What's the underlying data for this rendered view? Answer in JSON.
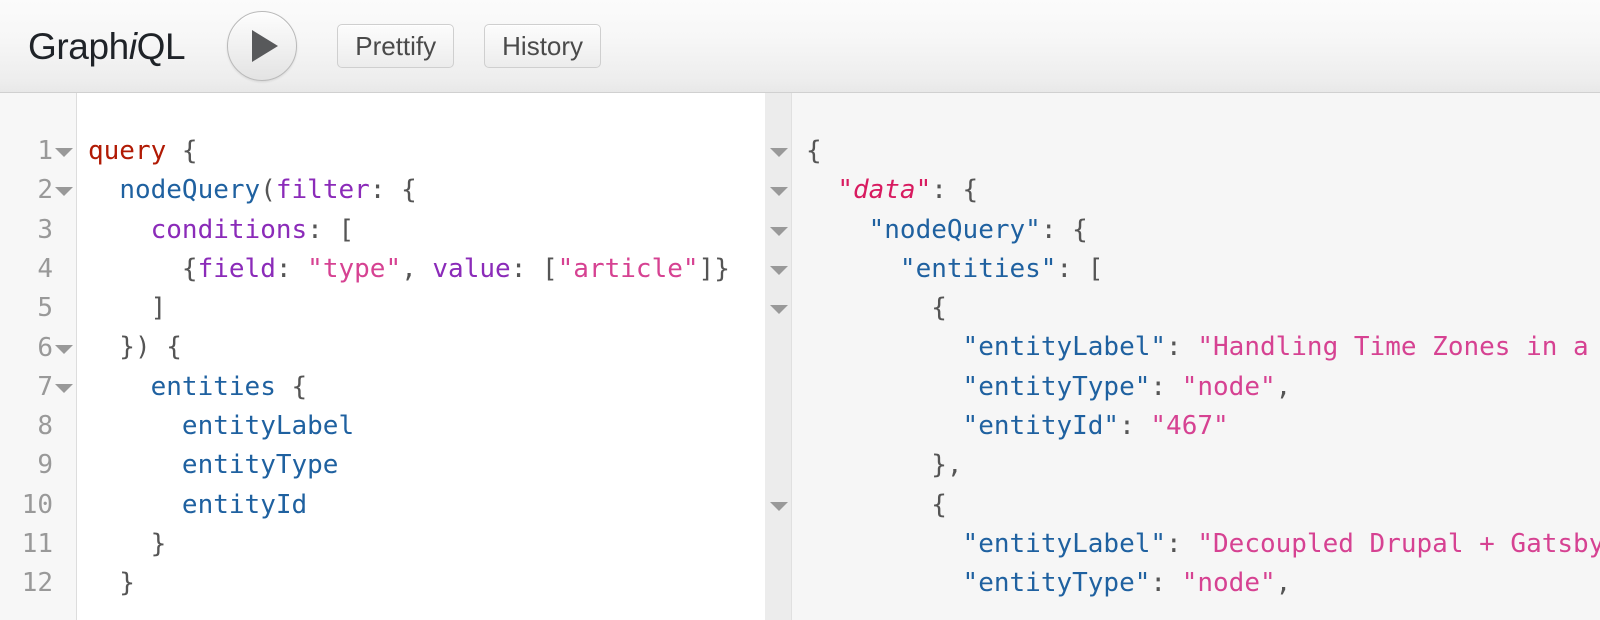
{
  "app": {
    "title": "GraphiQL",
    "title_prefix": "Graph",
    "title_em": "i",
    "title_suffix": "QL"
  },
  "toolbar": {
    "execute_label": "",
    "execute_icon": "play-icon",
    "prettify_label": "Prettify",
    "history_label": "History"
  },
  "query_editor": {
    "line_numbers": [
      "1",
      "2",
      "3",
      "4",
      "5",
      "6",
      "7",
      "8",
      "9",
      "10",
      "11",
      "12"
    ],
    "fold_lines": [
      1,
      2,
      6,
      7
    ],
    "lines": [
      [
        {
          "text": "query",
          "cls": "t-kw"
        },
        {
          "text": " {",
          "cls": "t-punct"
        }
      ],
      [
        {
          "text": "  ",
          "cls": "t-punct"
        },
        {
          "text": "nodeQuery",
          "cls": "t-def"
        },
        {
          "text": "(",
          "cls": "t-punct"
        },
        {
          "text": "filter",
          "cls": "t-attr"
        },
        {
          "text": ": {",
          "cls": "t-punct"
        }
      ],
      [
        {
          "text": "    ",
          "cls": "t-punct"
        },
        {
          "text": "conditions",
          "cls": "t-attr"
        },
        {
          "text": ": [",
          "cls": "t-punct"
        }
      ],
      [
        {
          "text": "      {",
          "cls": "t-punct"
        },
        {
          "text": "field",
          "cls": "t-attr"
        },
        {
          "text": ": ",
          "cls": "t-punct"
        },
        {
          "text": "\"type\"",
          "cls": "t-str"
        },
        {
          "text": ", ",
          "cls": "t-punct"
        },
        {
          "text": "value",
          "cls": "t-attr"
        },
        {
          "text": ": [",
          "cls": "t-punct"
        },
        {
          "text": "\"article\"",
          "cls": "t-str"
        },
        {
          "text": "]}",
          "cls": "t-punct"
        }
      ],
      [
        {
          "text": "    ]",
          "cls": "t-punct"
        }
      ],
      [
        {
          "text": "  }) {",
          "cls": "t-punct"
        }
      ],
      [
        {
          "text": "    ",
          "cls": "t-punct"
        },
        {
          "text": "entities",
          "cls": "t-def"
        },
        {
          "text": " {",
          "cls": "t-punct"
        }
      ],
      [
        {
          "text": "      ",
          "cls": "t-punct"
        },
        {
          "text": "entityLabel",
          "cls": "t-def"
        }
      ],
      [
        {
          "text": "      ",
          "cls": "t-punct"
        },
        {
          "text": "entityType",
          "cls": "t-def"
        }
      ],
      [
        {
          "text": "      ",
          "cls": "t-punct"
        },
        {
          "text": "entityId",
          "cls": "t-def"
        }
      ],
      [
        {
          "text": "    }",
          "cls": "t-punct"
        }
      ],
      [
        {
          "text": "  }",
          "cls": "t-punct"
        }
      ]
    ],
    "plain_text": "query {\n  nodeQuery(filter: {\n    conditions: [\n      {field: \"type\", value: [\"article\"]}\n    ]\n  }) {\n    entities {\n      entityLabel\n      entityType\n      entityId\n    }\n  }"
  },
  "result_viewer": {
    "fold_lines": [
      1,
      2,
      3,
      4,
      5,
      10
    ],
    "lines": [
      [
        {
          "text": "{",
          "cls": "t-brace"
        }
      ],
      [
        {
          "text": "  ",
          "cls": "t-brace"
        },
        {
          "text": "\"data\"",
          "cls": "t-data"
        },
        {
          "text": ": {",
          "cls": "t-brace"
        }
      ],
      [
        {
          "text": "    ",
          "cls": "t-brace"
        },
        {
          "text": "\"nodeQuery\"",
          "cls": "t-prop"
        },
        {
          "text": ": {",
          "cls": "t-brace"
        }
      ],
      [
        {
          "text": "      ",
          "cls": "t-brace"
        },
        {
          "text": "\"entities\"",
          "cls": "t-prop"
        },
        {
          "text": ": [",
          "cls": "t-brace"
        }
      ],
      [
        {
          "text": "        {",
          "cls": "t-brace"
        }
      ],
      [
        {
          "text": "          ",
          "cls": "t-brace"
        },
        {
          "text": "\"entityLabel\"",
          "cls": "t-prop"
        },
        {
          "text": ": ",
          "cls": "t-brace"
        },
        {
          "text": "\"Handling Time Zones in a",
          "cls": "t-str"
        }
      ],
      [
        {
          "text": "          ",
          "cls": "t-brace"
        },
        {
          "text": "\"entityType\"",
          "cls": "t-prop"
        },
        {
          "text": ": ",
          "cls": "t-brace"
        },
        {
          "text": "\"node\"",
          "cls": "t-str"
        },
        {
          "text": ",",
          "cls": "t-brace"
        }
      ],
      [
        {
          "text": "          ",
          "cls": "t-brace"
        },
        {
          "text": "\"entityId\"",
          "cls": "t-prop"
        },
        {
          "text": ": ",
          "cls": "t-brace"
        },
        {
          "text": "\"467\"",
          "cls": "t-str"
        }
      ],
      [
        {
          "text": "        },",
          "cls": "t-brace"
        }
      ],
      [
        {
          "text": "        {",
          "cls": "t-brace"
        }
      ],
      [
        {
          "text": "          ",
          "cls": "t-brace"
        },
        {
          "text": "\"entityLabel\"",
          "cls": "t-prop"
        },
        {
          "text": ": ",
          "cls": "t-brace"
        },
        {
          "text": "\"Decoupled Drupal + Gatsby",
          "cls": "t-str"
        }
      ],
      [
        {
          "text": "          ",
          "cls": "t-brace"
        },
        {
          "text": "\"entityType\"",
          "cls": "t-prop"
        },
        {
          "text": ": ",
          "cls": "t-brace"
        },
        {
          "text": "\"node\"",
          "cls": "t-str"
        },
        {
          "text": ",",
          "cls": "t-brace"
        }
      ]
    ],
    "entities": [
      {
        "entityLabel": "Handling Time Zones in a",
        "entityType": "node",
        "entityId": "467"
      },
      {
        "entityLabel": "Decoupled Drupal + Gatsby",
        "entityType": "node"
      }
    ],
    "plain_text": "{\n  \"data\": {\n    \"nodeQuery\": {\n      \"entities\": [\n        {\n          \"entityLabel\": \"Handling Time Zones in a\n          \"entityType\": \"node\",\n          \"entityId\": \"467\"\n        },\n        {\n          \"entityLabel\": \"Decoupled Drupal + Gatsby\n          \"entityType\": \"node\","
  },
  "colors": {
    "keyword": "#b11a04",
    "definition": "#1f61a0",
    "attribute": "#8b2bb9",
    "string": "#d64292",
    "punctuation": "#555555",
    "data_key": "#d81b60",
    "gutter_text": "#999999",
    "toolbar_bg": "#f2f2f2",
    "result_bg": "#f6f6f6"
  }
}
